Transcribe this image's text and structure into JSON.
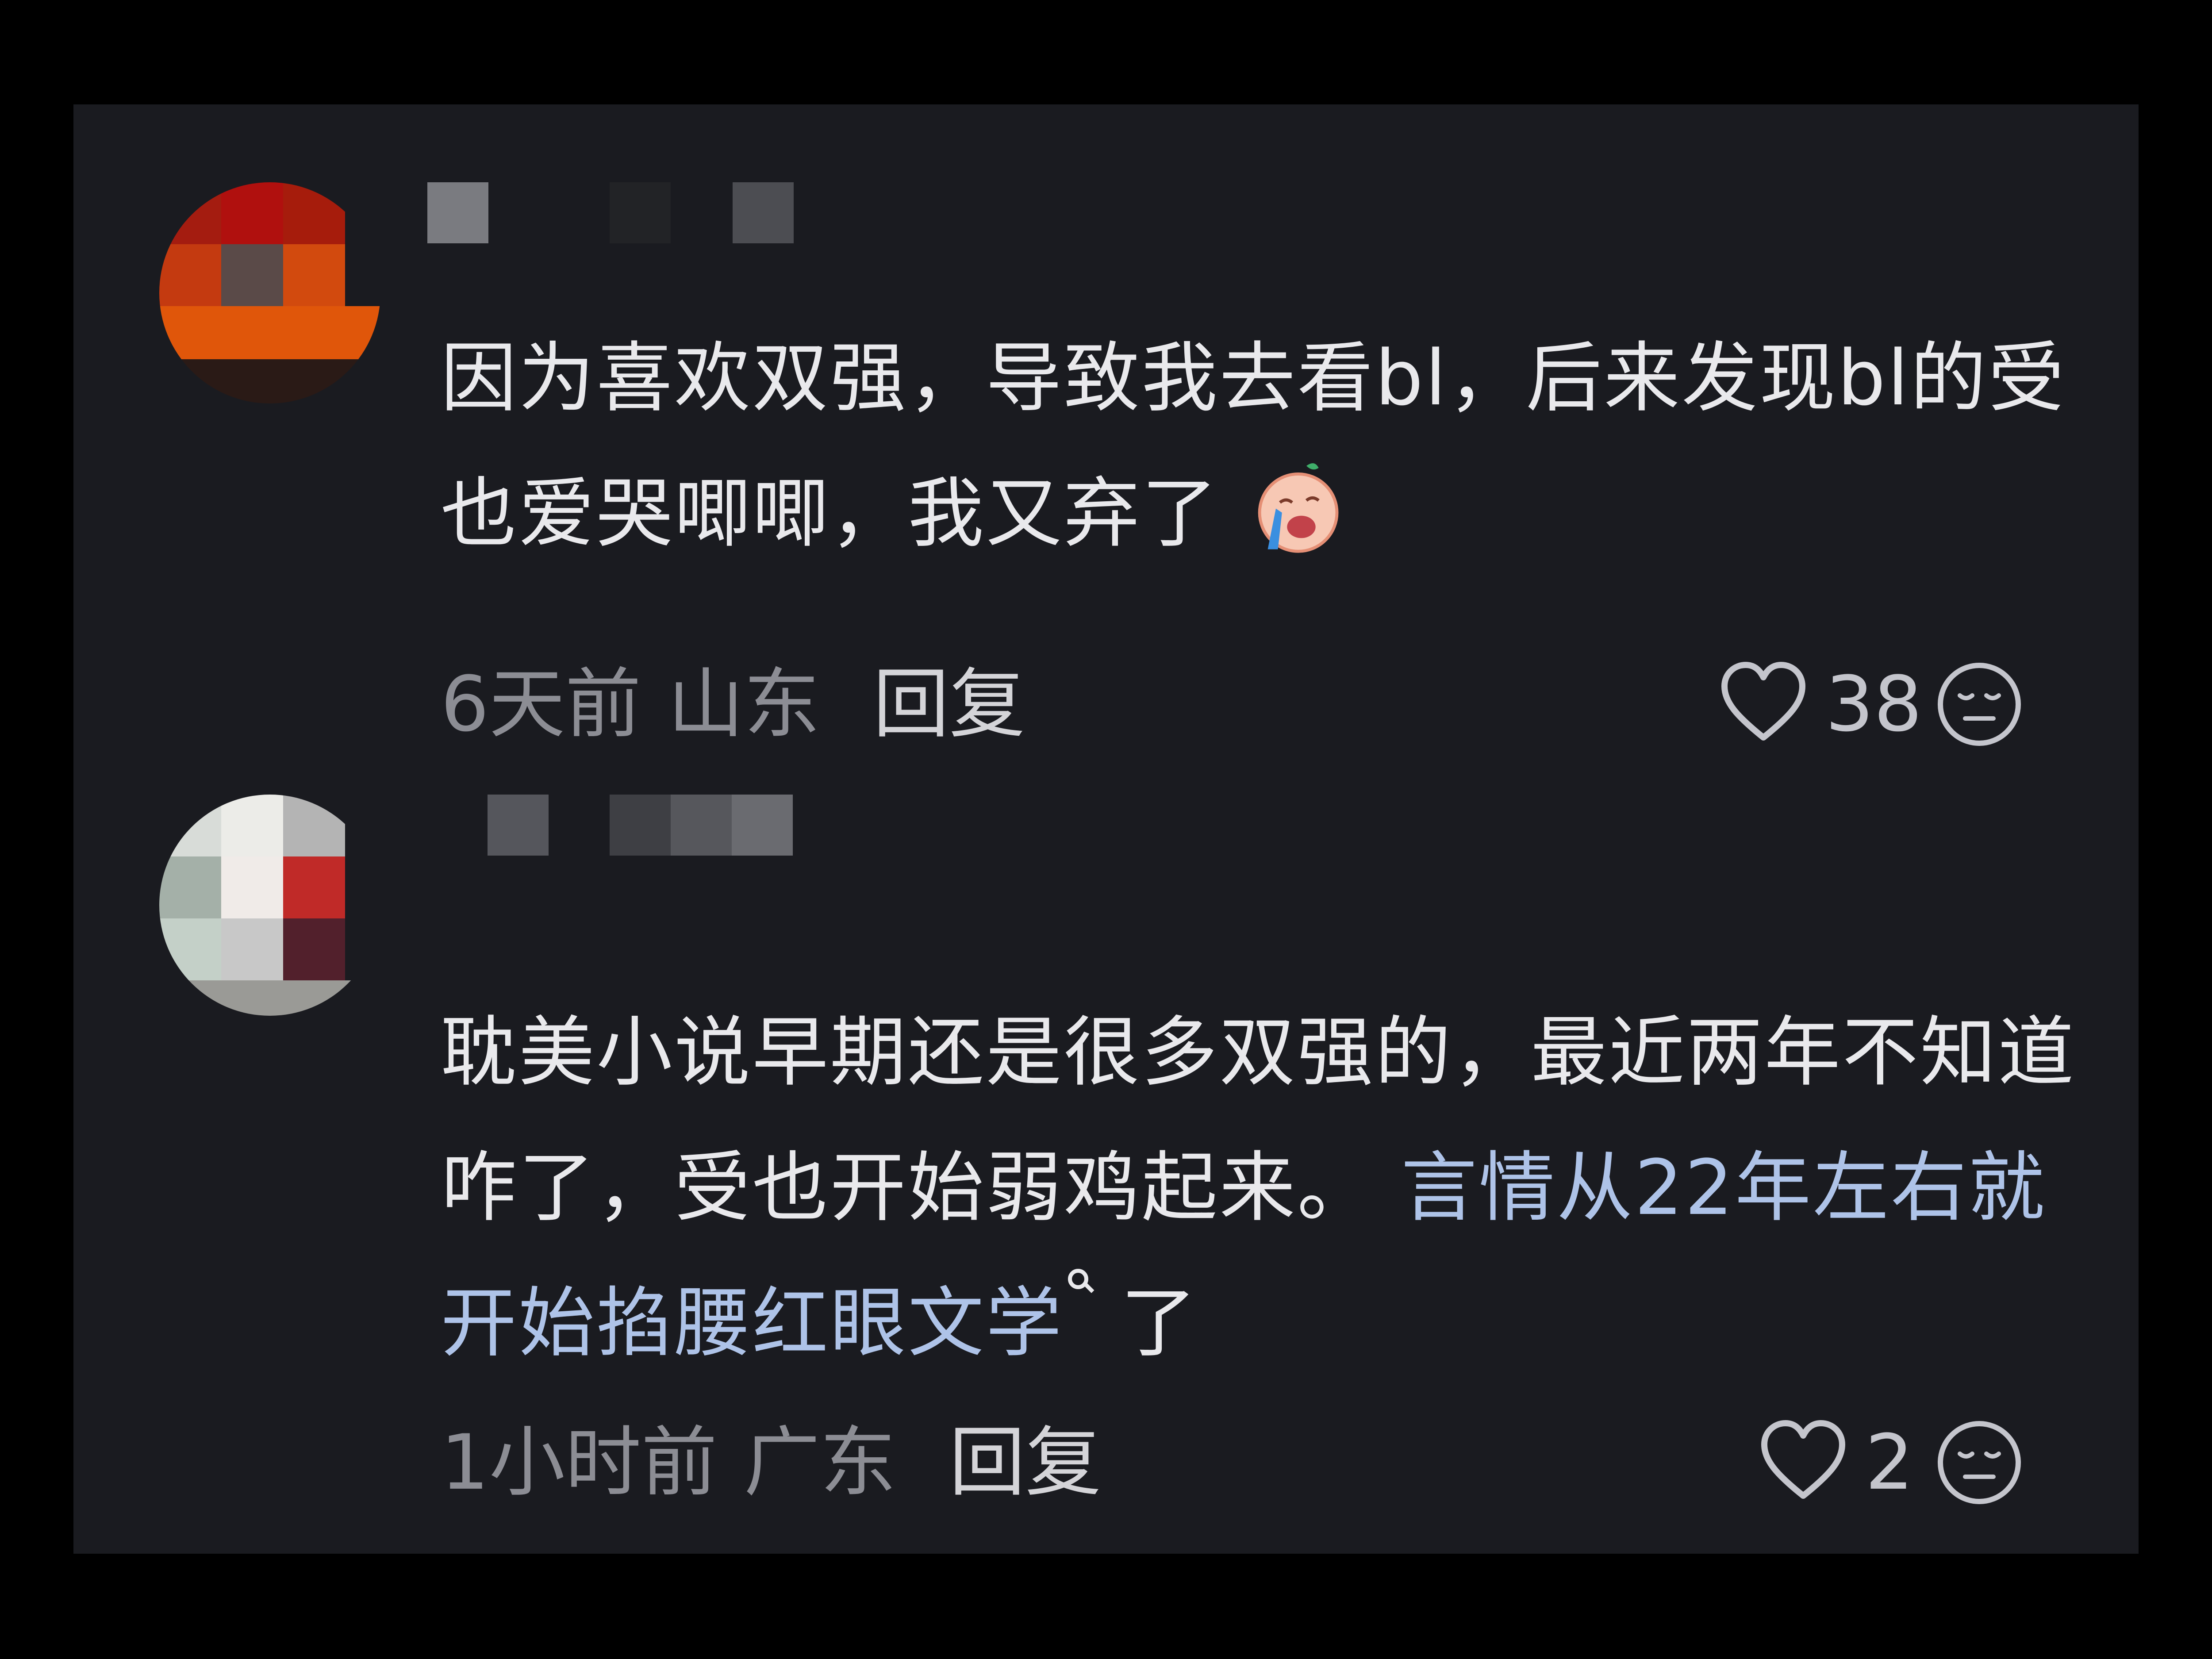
{
  "comments": [
    {
      "text": "因为喜欢双强，导致我去看bl，后来发现bl的受也爱哭唧唧，我又弃了",
      "emoji": "crying-baby-emoji",
      "time": "6天前",
      "location": "山东",
      "reply_label": "回复",
      "likes": "38"
    },
    {
      "text_plain": "耽美小说早期还是很多双强的，最近两年不知道咋了，受也开始弱鸡起来。",
      "text_highlight": "言情从22年左右就开始掐腰红眼文学",
      "text_tail": "了",
      "time": "1小时前",
      "location": "广东",
      "reply_label": "回复",
      "likes": "2"
    }
  ],
  "colors": {
    "background": "#000000",
    "panel": "#1a1b20",
    "text": "#e9e9ec",
    "meta": "#8c8d94",
    "highlight": "#aec3e8"
  }
}
